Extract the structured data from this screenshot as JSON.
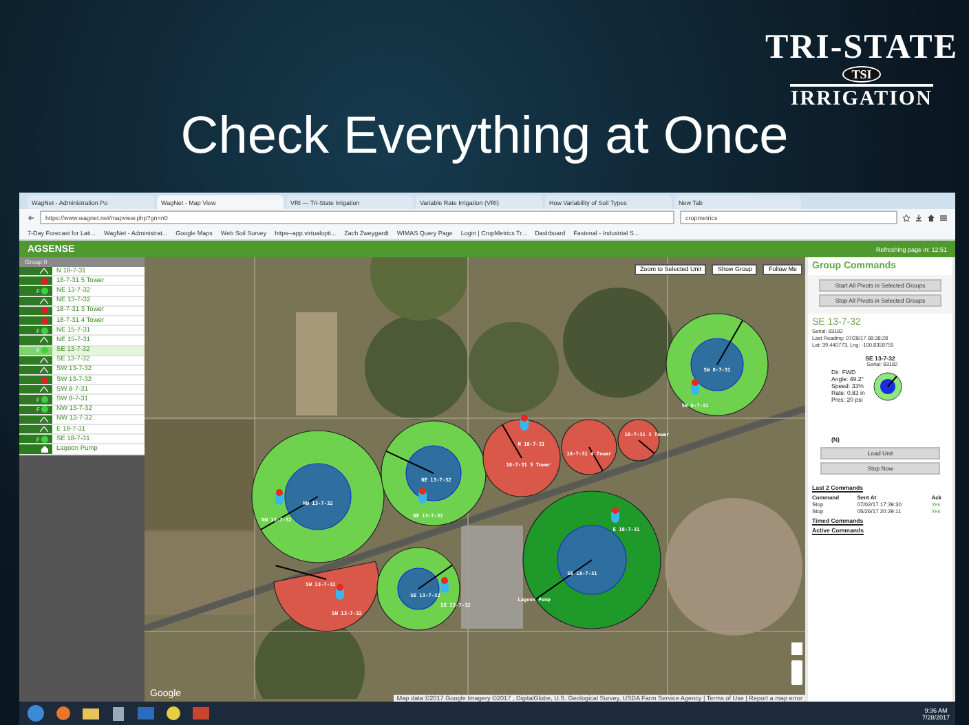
{
  "slide": {
    "logo": {
      "top": "TRI-STATE",
      "badge": "TSI",
      "bottom": "IRRIGATION"
    },
    "title": "Check Everything at Once"
  },
  "browser": {
    "tabs": [
      {
        "label": "WagNet - Administration Po",
        "selected": false
      },
      {
        "label": "WagNet - Map View",
        "selected": true
      },
      {
        "label": "VRI — Tri-State Irrigation",
        "selected": false
      },
      {
        "label": "Variable Rate Irrigation (VRI)",
        "selected": false
      },
      {
        "label": "How Variability of Soil Types",
        "selected": false
      },
      {
        "label": "New Tab",
        "selected": false
      }
    ],
    "address": "https://www.wagnet.net/mapview.php?gn=n0",
    "search": "cropmetrics",
    "bookmarks": [
      "7-Day Forecast for Lati...",
      "WagNet - Administrat...",
      "Google Maps",
      "Web Soil Survey",
      "https--app.virtualopti...",
      "Zach Zweygardt",
      "WIMAS Query Page",
      "Login | CropMetrics Tr...",
      "Dashboard",
      "Fastenal - Industrial S..."
    ]
  },
  "app": {
    "brand": "AGSENSE",
    "refresh": "Refreshing page in: 12:51"
  },
  "unit_list": {
    "header": "Group 0",
    "items": [
      {
        "name": "N 18-7-31",
        "kind": "idle",
        "selected": false
      },
      {
        "name": "18-7-31 5 Tower",
        "kind": "stopped",
        "selected": false
      },
      {
        "name": "NE 13-7-32",
        "kind": "running",
        "dir": "F",
        "selected": false
      },
      {
        "name": "NE 13-7-32",
        "kind": "idle",
        "selected": false
      },
      {
        "name": "18-7-31 3 Tower",
        "kind": "stopped",
        "selected": false
      },
      {
        "name": "18-7-31 4 Tower",
        "kind": "stopped",
        "selected": false
      },
      {
        "name": "NE 15-7-31",
        "kind": "running",
        "dir": "F",
        "selected": false
      },
      {
        "name": "NE 15-7-31",
        "kind": "idle",
        "selected": false
      },
      {
        "name": "SE 13-7-32",
        "kind": "running",
        "dir": "F",
        "selected": true
      },
      {
        "name": "SE 13-7-32",
        "kind": "idle",
        "selected": false
      },
      {
        "name": "SW 13-7-32",
        "kind": "idle",
        "selected": false
      },
      {
        "name": "SW 13-7-32",
        "kind": "stopped",
        "selected": false
      },
      {
        "name": "SW 8-7-31",
        "kind": "idle",
        "selected": false
      },
      {
        "name": "SW 8-7-31",
        "kind": "running",
        "dir": "F",
        "selected": false
      },
      {
        "name": "NW 13-7-32",
        "kind": "running",
        "dir": "F",
        "selected": false
      },
      {
        "name": "NW 13-7-32",
        "kind": "idle",
        "selected": false
      },
      {
        "name": "E 18-7-31",
        "kind": "idle",
        "selected": false
      },
      {
        "name": "SE 18-7-31",
        "kind": "running",
        "dir": "F",
        "selected": false
      },
      {
        "name": "Lagoon Pump",
        "kind": "pump",
        "selected": false
      }
    ]
  },
  "map": {
    "buttons": [
      "Zoom to Selected Unit",
      "Show Group",
      "Follow Me"
    ],
    "pivots": [
      {
        "kind": "applied",
        "color": "#6fd24f",
        "labels": [
          "SW 8-7-31",
          "SW 8-7-31"
        ]
      },
      {
        "kind": "applied",
        "color": "#6fd24f",
        "labels": [
          "NW 13-7-32",
          "NW 13-7-32"
        ]
      },
      {
        "kind": "applied",
        "color": "#6fd24f",
        "labels": [
          "NE 13-7-32",
          "NE 13-7-32"
        ]
      },
      {
        "kind": "full",
        "color": "#d9584a",
        "labels": [
          "N 18-7-31",
          "18-7-31 5 Tower"
        ]
      },
      {
        "kind": "full",
        "color": "#d9584a",
        "labels": [
          "18-7-31 4 Tower"
        ]
      },
      {
        "kind": "full",
        "color": "#d9584a",
        "labels": [
          "18-7-31 3 Tower"
        ]
      },
      {
        "kind": "wedge",
        "color": "#d9584a",
        "labels": [
          "SW 13-7-32",
          "SW 13-7-32"
        ]
      },
      {
        "kind": "applied",
        "color": "#6fd24f",
        "labels": [
          "SE 13-7-32",
          "SE 13-7-32"
        ]
      },
      {
        "kind": "applied",
        "color": "#1f9a2a",
        "labels": [
          "E 18-7-31",
          "SE 18-7-31",
          "Lagoon Pump"
        ]
      }
    ],
    "google": "Google",
    "attribution": "Map data ©2017 Google Imagery ©2017 , DigitalGlobe, U.S. Geological Survey, USDA Farm Service Agency | Terms of Use | Report a map error"
  },
  "panel": {
    "title": "Group Commands",
    "group_buttons": [
      "Start All Pivots in Selected Groups",
      "Stop All Pivots in Selected Groups"
    ],
    "unit": {
      "name": "SE 13-7-32",
      "serial": "Serial: 83182",
      "last_reading": "Last Reading: 07/28/17 08:38:28",
      "location": "Lat: 39.440773, Lng: -100.8358755"
    },
    "detail": {
      "name": "SE 13-7-32",
      "serial": "Serial: 83182",
      "lines": [
        "Dir: FWD",
        "Angle: 49.2°",
        "Speed: 33%",
        "Rate: 0.83 in",
        "Pres: 20 psi"
      ],
      "mark": "(N)"
    },
    "unit_buttons": [
      "Load Unit",
      "Stop Now"
    ],
    "last_commands": {
      "title": "Last 2 Commands",
      "columns": [
        "Command",
        "Sent At",
        "Ack"
      ],
      "rows": [
        [
          "Stop",
          "07/02/17 17:39:30",
          "Yes"
        ],
        [
          "Stop",
          "05/26/17 20:29:11",
          "Yes"
        ]
      ]
    },
    "links": [
      "Timed Commands",
      "Active Commands"
    ]
  },
  "taskbar": {
    "time": "9:36 AM",
    "date": "7/28/2017"
  }
}
